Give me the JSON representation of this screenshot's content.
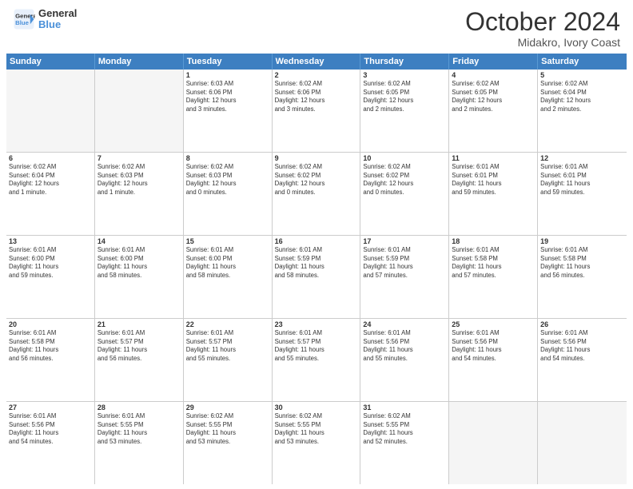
{
  "header": {
    "logo_line1": "General",
    "logo_line2": "Blue",
    "month": "October 2024",
    "location": "Midakro, Ivory Coast"
  },
  "weekdays": [
    "Sunday",
    "Monday",
    "Tuesday",
    "Wednesday",
    "Thursday",
    "Friday",
    "Saturday"
  ],
  "weeks": [
    [
      {
        "date": "",
        "info": ""
      },
      {
        "date": "",
        "info": ""
      },
      {
        "date": "1",
        "info": "Sunrise: 6:03 AM\nSunset: 6:06 PM\nDaylight: 12 hours\nand 3 minutes."
      },
      {
        "date": "2",
        "info": "Sunrise: 6:02 AM\nSunset: 6:06 PM\nDaylight: 12 hours\nand 3 minutes."
      },
      {
        "date": "3",
        "info": "Sunrise: 6:02 AM\nSunset: 6:05 PM\nDaylight: 12 hours\nand 2 minutes."
      },
      {
        "date": "4",
        "info": "Sunrise: 6:02 AM\nSunset: 6:05 PM\nDaylight: 12 hours\nand 2 minutes."
      },
      {
        "date": "5",
        "info": "Sunrise: 6:02 AM\nSunset: 6:04 PM\nDaylight: 12 hours\nand 2 minutes."
      }
    ],
    [
      {
        "date": "6",
        "info": "Sunrise: 6:02 AM\nSunset: 6:04 PM\nDaylight: 12 hours\nand 1 minute."
      },
      {
        "date": "7",
        "info": "Sunrise: 6:02 AM\nSunset: 6:03 PM\nDaylight: 12 hours\nand 1 minute."
      },
      {
        "date": "8",
        "info": "Sunrise: 6:02 AM\nSunset: 6:03 PM\nDaylight: 12 hours\nand 0 minutes."
      },
      {
        "date": "9",
        "info": "Sunrise: 6:02 AM\nSunset: 6:02 PM\nDaylight: 12 hours\nand 0 minutes."
      },
      {
        "date": "10",
        "info": "Sunrise: 6:02 AM\nSunset: 6:02 PM\nDaylight: 12 hours\nand 0 minutes."
      },
      {
        "date": "11",
        "info": "Sunrise: 6:01 AM\nSunset: 6:01 PM\nDaylight: 11 hours\nand 59 minutes."
      },
      {
        "date": "12",
        "info": "Sunrise: 6:01 AM\nSunset: 6:01 PM\nDaylight: 11 hours\nand 59 minutes."
      }
    ],
    [
      {
        "date": "13",
        "info": "Sunrise: 6:01 AM\nSunset: 6:00 PM\nDaylight: 11 hours\nand 59 minutes."
      },
      {
        "date": "14",
        "info": "Sunrise: 6:01 AM\nSunset: 6:00 PM\nDaylight: 11 hours\nand 58 minutes."
      },
      {
        "date": "15",
        "info": "Sunrise: 6:01 AM\nSunset: 6:00 PM\nDaylight: 11 hours\nand 58 minutes."
      },
      {
        "date": "16",
        "info": "Sunrise: 6:01 AM\nSunset: 5:59 PM\nDaylight: 11 hours\nand 58 minutes."
      },
      {
        "date": "17",
        "info": "Sunrise: 6:01 AM\nSunset: 5:59 PM\nDaylight: 11 hours\nand 57 minutes."
      },
      {
        "date": "18",
        "info": "Sunrise: 6:01 AM\nSunset: 5:58 PM\nDaylight: 11 hours\nand 57 minutes."
      },
      {
        "date": "19",
        "info": "Sunrise: 6:01 AM\nSunset: 5:58 PM\nDaylight: 11 hours\nand 56 minutes."
      }
    ],
    [
      {
        "date": "20",
        "info": "Sunrise: 6:01 AM\nSunset: 5:58 PM\nDaylight: 11 hours\nand 56 minutes."
      },
      {
        "date": "21",
        "info": "Sunrise: 6:01 AM\nSunset: 5:57 PM\nDaylight: 11 hours\nand 56 minutes."
      },
      {
        "date": "22",
        "info": "Sunrise: 6:01 AM\nSunset: 5:57 PM\nDaylight: 11 hours\nand 55 minutes."
      },
      {
        "date": "23",
        "info": "Sunrise: 6:01 AM\nSunset: 5:57 PM\nDaylight: 11 hours\nand 55 minutes."
      },
      {
        "date": "24",
        "info": "Sunrise: 6:01 AM\nSunset: 5:56 PM\nDaylight: 11 hours\nand 55 minutes."
      },
      {
        "date": "25",
        "info": "Sunrise: 6:01 AM\nSunset: 5:56 PM\nDaylight: 11 hours\nand 54 minutes."
      },
      {
        "date": "26",
        "info": "Sunrise: 6:01 AM\nSunset: 5:56 PM\nDaylight: 11 hours\nand 54 minutes."
      }
    ],
    [
      {
        "date": "27",
        "info": "Sunrise: 6:01 AM\nSunset: 5:56 PM\nDaylight: 11 hours\nand 54 minutes."
      },
      {
        "date": "28",
        "info": "Sunrise: 6:01 AM\nSunset: 5:55 PM\nDaylight: 11 hours\nand 53 minutes."
      },
      {
        "date": "29",
        "info": "Sunrise: 6:02 AM\nSunset: 5:55 PM\nDaylight: 11 hours\nand 53 minutes."
      },
      {
        "date": "30",
        "info": "Sunrise: 6:02 AM\nSunset: 5:55 PM\nDaylight: 11 hours\nand 53 minutes."
      },
      {
        "date": "31",
        "info": "Sunrise: 6:02 AM\nSunset: 5:55 PM\nDaylight: 11 hours\nand 52 minutes."
      },
      {
        "date": "",
        "info": ""
      },
      {
        "date": "",
        "info": ""
      }
    ]
  ]
}
